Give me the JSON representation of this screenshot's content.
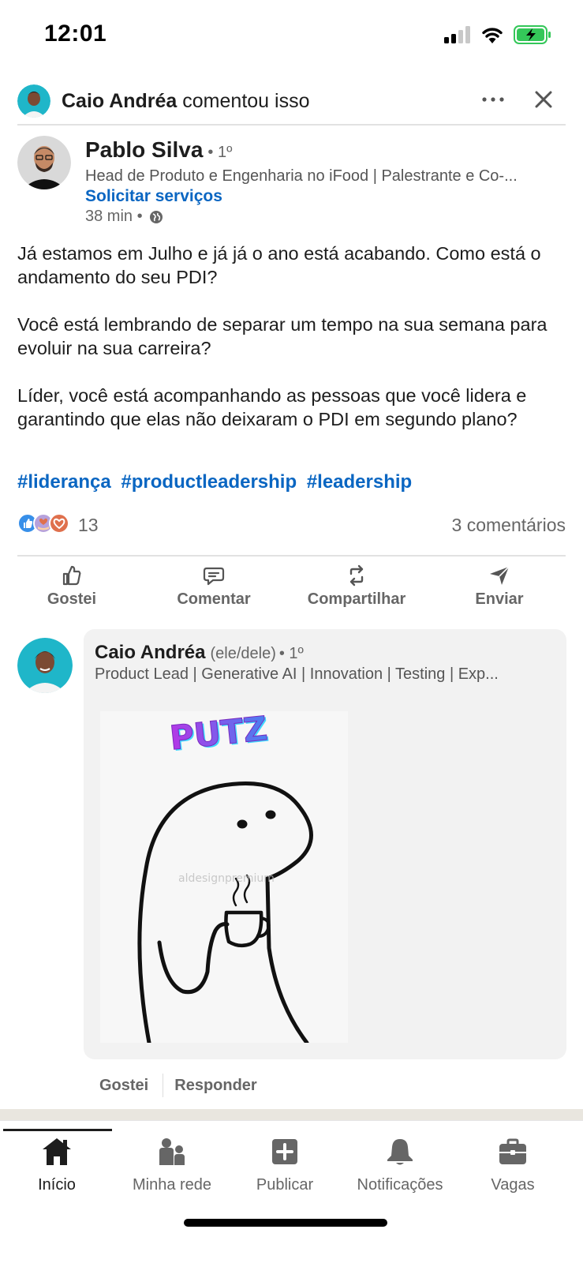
{
  "status_bar": {
    "time": "12:01"
  },
  "activity": {
    "actor": "Caio Andréa",
    "action": "comentou isso"
  },
  "post": {
    "author_name": "Pablo Silva",
    "degree": "• 1º",
    "headline": "Head de Produto e Engenharia no iFood | Palestrante e Co-...",
    "services_link": "Solicitar serviços",
    "time": "38 min •",
    "paragraphs": [
      "Já estamos em Julho e já já o ano está acabando. Como está o andamento do seu PDI?",
      "Você está lembrando de separar um tempo na sua semana para evoluir na sua carreira?",
      "Líder, você está acompanhando as pessoas que você lidera e garantindo que elas não deixaram o PDI em segundo plano?"
    ],
    "hashtags": [
      "#liderança",
      "#productleadership",
      "#leadership"
    ],
    "reaction_count": "13",
    "comments_count": "3 comentários"
  },
  "actions": [
    "Gostei",
    "Comentar",
    "Compartilhar",
    "Enviar"
  ],
  "comment": {
    "author_name": "Caio Andréa",
    "pronouns": "(ele/dele)",
    "degree": "• 1º",
    "headline": "Product Lead | Generative AI | Innovation | Testing | Exp...",
    "sticker_text": "PUTZ",
    "watermark": "aldesignpremium",
    "like_label": "Gostei",
    "reply_label": "Responder"
  },
  "nav": {
    "items": [
      "Início",
      "Minha rede",
      "Publicar",
      "Notificações",
      "Vagas"
    ],
    "active": "Início"
  },
  "colors": {
    "link_blue": "#0a66c2",
    "battery_green": "#34c759"
  }
}
